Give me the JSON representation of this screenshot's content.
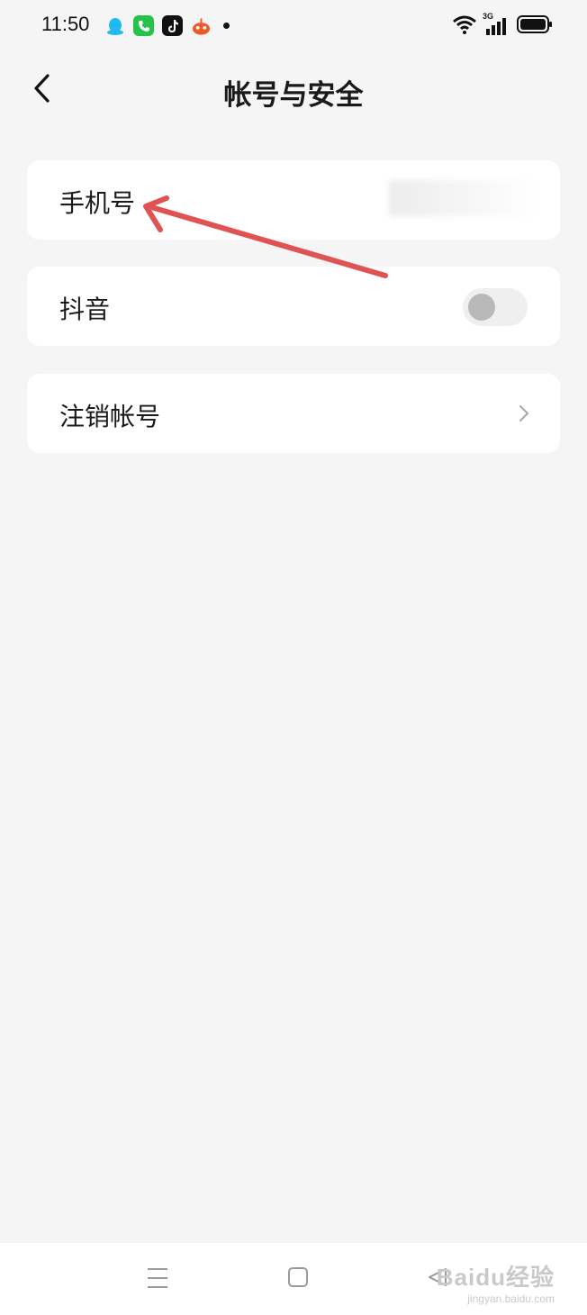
{
  "status_bar": {
    "time": "11:50",
    "app_icons": [
      "qq-icon",
      "phone-icon",
      "tiktok-icon",
      "toutiao-icon"
    ],
    "network": "3G"
  },
  "header": {
    "title": "帐号与安全"
  },
  "settings": {
    "phone": {
      "label": "手机号"
    },
    "douyin": {
      "label": "抖音",
      "toggle_on": false
    },
    "deactivate": {
      "label": "注销帐号"
    }
  },
  "watermark": {
    "brand": "Baidu经验",
    "url": "jingyan.baidu.com"
  },
  "colors": {
    "background": "#f5f5f5",
    "card": "#ffffff",
    "annotation_arrow": "#e05353"
  }
}
